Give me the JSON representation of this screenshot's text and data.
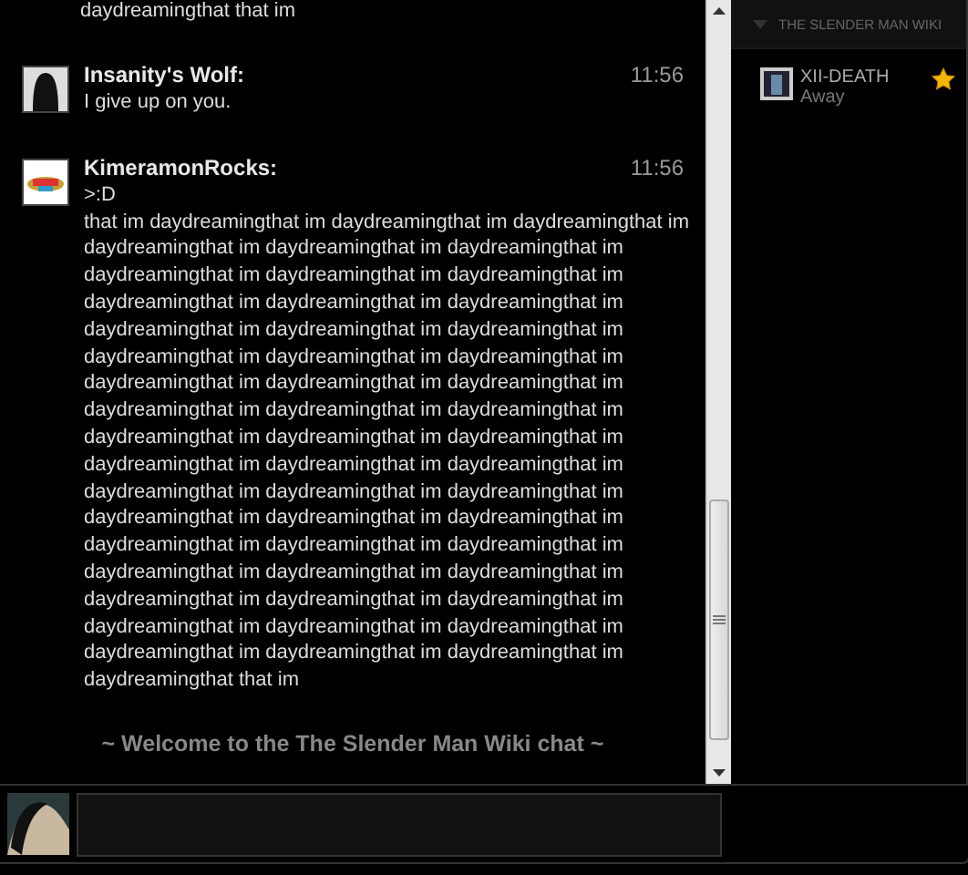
{
  "chat": {
    "previous_tail": "daydreamingthat that im",
    "messages": [
      {
        "author": "Insanity's Wolf:",
        "time": "11:56",
        "lines": [
          "I give up on you."
        ]
      },
      {
        "author": "KimeramonRocks:",
        "time": "11:56",
        "lines": [
          ">:D",
          "that im daydreamingthat im daydreamingthat im daydreamingthat im",
          "daydreamingthat im daydreamingthat im daydreamingthat im",
          "daydreamingthat im daydreamingthat im daydreamingthat im",
          "daydreamingthat im daydreamingthat im daydreamingthat im",
          "daydreamingthat im daydreamingthat im daydreamingthat im",
          "daydreamingthat im daydreamingthat im daydreamingthat im",
          "daydreamingthat im daydreamingthat im daydreamingthat im",
          "daydreamingthat im daydreamingthat im daydreamingthat im",
          "daydreamingthat im daydreamingthat im daydreamingthat im",
          "daydreamingthat im daydreamingthat im daydreamingthat im",
          "daydreamingthat im daydreamingthat im daydreamingthat im",
          "daydreamingthat im daydreamingthat im daydreamingthat im",
          "daydreamingthat im daydreamingthat im daydreamingthat im",
          "daydreamingthat im daydreamingthat im daydreamingthat im",
          "daydreamingthat im daydreamingthat im daydreamingthat im",
          "daydreamingthat im daydreamingthat im daydreamingthat im",
          "daydreamingthat im daydreamingthat im daydreamingthat im",
          "daydreamingthat that im"
        ]
      }
    ],
    "welcome": "~ Welcome to the The Slender Man Wiki chat ~"
  },
  "sidebar": {
    "wiki_title": "THE SLENDER MAN WIKI",
    "users": [
      {
        "name": "XII-DEATH",
        "status": "Away",
        "starred": true
      }
    ]
  }
}
